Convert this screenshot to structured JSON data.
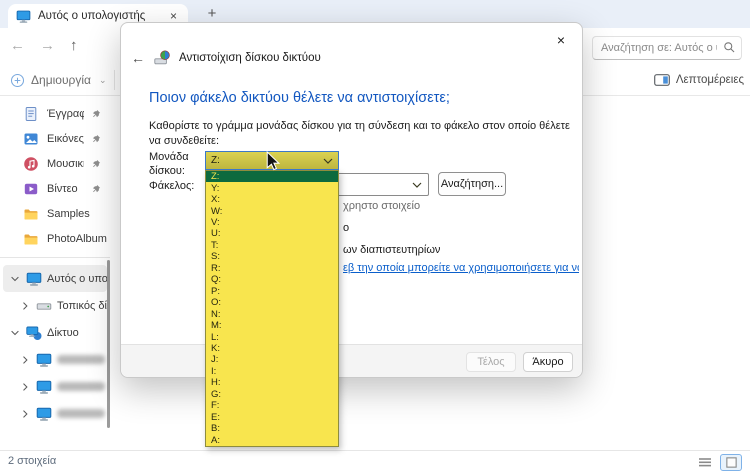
{
  "glyphs": {
    "close": "×",
    "plus": "+",
    "back": "←",
    "forward": "→",
    "up": "↑",
    "chevron_down": "⌄"
  },
  "colors": {
    "dropdown_yellow": "#f8e54e",
    "dropdown_selected_green": "#0d6a3e",
    "combo_yellow_top": "#dbd251",
    "combo_yellow_bottom": "#bdb640",
    "heading_blue": "#1257c0",
    "link_blue": "#0b5fcb",
    "tabbar_bg": "#e9eff8"
  },
  "window": {
    "tab_title": "Αυτός ο υπολογιστής",
    "search_placeholder": "Αναζήτηση σε: Αυτός ο υ",
    "new_button_label": "Δημιουργία",
    "details_button_label": "Λεπτομέρειες",
    "status_count": "2 στοιχεία",
    "sidebar_pinned": [
      {
        "label": "Έγγραφα",
        "icon": "icon-document",
        "pinned": true
      },
      {
        "label": "Εικόνες",
        "icon": "icon-pictures",
        "pinned": true
      },
      {
        "label": "Μουσική",
        "icon": "icon-music",
        "pinned": true
      },
      {
        "label": "Βίντεο",
        "icon": "icon-video",
        "pinned": true
      },
      {
        "label": "Samples",
        "icon": "icon-folder",
        "pinned": false
      },
      {
        "label": "PhotoAlbum",
        "icon": "icon-folder",
        "pinned": false
      }
    ],
    "sidebar_tree": [
      {
        "label": "Αυτός ο υπολογ",
        "icon": "icon-monitor",
        "chevron": "down",
        "selected": true,
        "indent": 0,
        "redacted": false
      },
      {
        "label": "Τοπικός δίσκο",
        "icon": "icon-drive",
        "chevron": "right",
        "selected": false,
        "indent": 1,
        "redacted": false
      },
      {
        "label": "Δίκτυο",
        "icon": "icon-network",
        "chevron": "down",
        "selected": false,
        "indent": 0,
        "redacted": false
      },
      {
        "label": "",
        "icon": "icon-monitor",
        "chevron": "right",
        "selected": false,
        "indent": 1,
        "redacted": true
      },
      {
        "label": "",
        "icon": "icon-monitor",
        "chevron": "right",
        "selected": false,
        "indent": 1,
        "redacted": true
      },
      {
        "label": "",
        "icon": "icon-monitor",
        "chevron": "right",
        "selected": false,
        "indent": 1,
        "redacted": true
      }
    ]
  },
  "dialog": {
    "title": "Αντιστοίχιση δίσκου δικτύου",
    "heading": "Ποιον φάκελο δικτύου θέλετε να αντιστοιχίσετε;",
    "description": "Καθορίστε το γράμμα μονάδας δίσκου για τη σύνδεση και το φάκελο στον οποίο θέλετε να συνδεθείτε:",
    "drive_label": "Μονάδα δίσκου:",
    "folder_label": "Φάκελος:",
    "folder_value": "",
    "browse_button": "Αναζήτηση...",
    "finish_button": "Τέλος",
    "cancel_button": "Άκυρο",
    "drive_dropdown": {
      "selected": "Z:",
      "options": [
        "Z:",
        "Y:",
        "X:",
        "W:",
        "V:",
        "U:",
        "T:",
        "S:",
        "R:",
        "Q:",
        "P:",
        "O:",
        "N:",
        "M:",
        "L:",
        "K:",
        "J:",
        "I:",
        "H:",
        "G:",
        "F:",
        "E:",
        "B:",
        "A:"
      ]
    },
    "partial_texts": {
      "example_fragment": "χρηστο στοιχείο",
      "reconnect_fragment": "ο",
      "credentials_fragment": "ων διαπιστευτηρίων",
      "link_fragment": "εβ την οποία μπορείτε να χρησιμοποιήσετε για να αποθη"
    }
  }
}
